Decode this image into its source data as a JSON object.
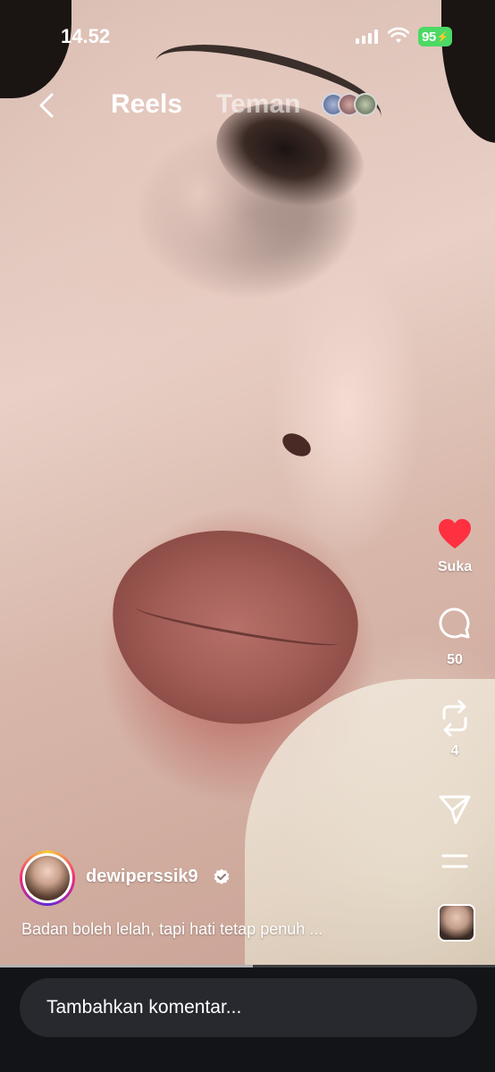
{
  "status_bar": {
    "time": "14.52",
    "battery": "95",
    "battery_color": "#4cd964"
  },
  "header": {
    "back_icon": "chevron-left-icon",
    "tab_reels": "Reels",
    "tab_friends": "Teman"
  },
  "actions": {
    "like": {
      "icon": "heart-icon",
      "label": "Suka",
      "active": true,
      "color": "#ff3040"
    },
    "comment": {
      "icon": "comment-icon",
      "count": "50"
    },
    "repost": {
      "icon": "repost-icon",
      "count": "4"
    },
    "share": {
      "icon": "send-icon"
    },
    "more": {
      "icon": "more-icon"
    }
  },
  "author": {
    "username": "dewiperssik9",
    "verified": true,
    "caption": "Badan boleh lelah, tapi hati tetap penuh ..."
  },
  "playback": {
    "progress": 0.51
  },
  "comment_bar": {
    "placeholder": "Tambahkan komentar..."
  }
}
